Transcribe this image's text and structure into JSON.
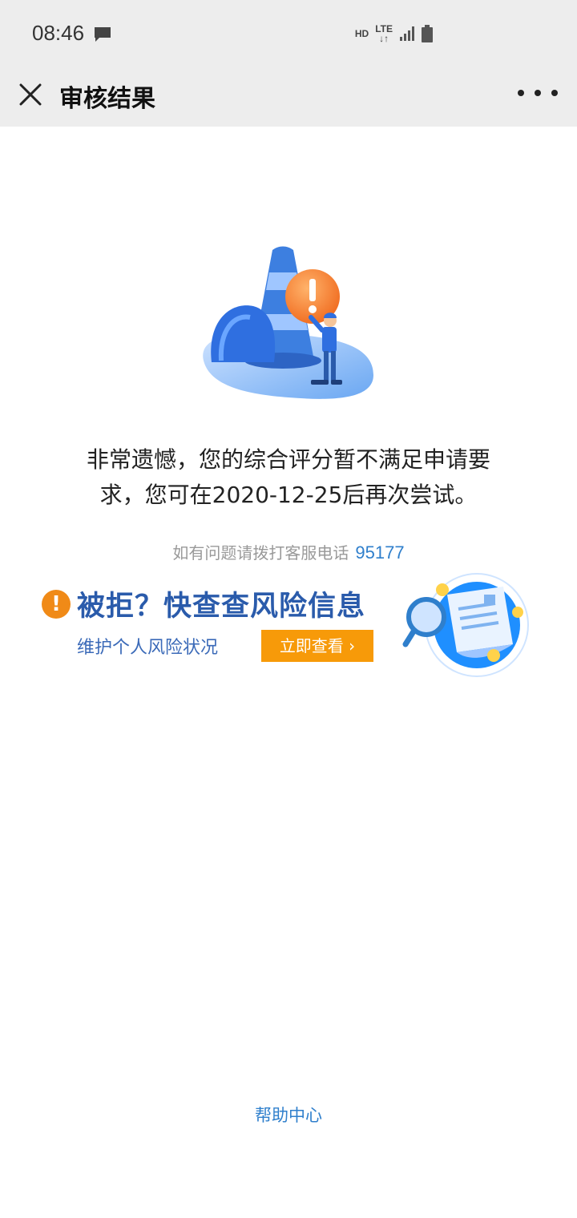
{
  "status_bar": {
    "time": "08:46",
    "hd": "HD",
    "lte": "LTE",
    "icons": [
      "message-icon",
      "signal-icon",
      "battery-icon"
    ]
  },
  "nav": {
    "title": "审核结果",
    "close_icon": "close-icon",
    "more_icon": "more-icon"
  },
  "result": {
    "message": "非常遗憾，您的综合评分暂不满足申请要求，您可在2020-12-25后再次尝试。",
    "help_text": "如有问题请拨打客服电话",
    "help_phone": "95177"
  },
  "banner": {
    "title": "被拒？快查查风险信息",
    "subtitle": "维护个人风险状况",
    "cta": "立即查看 ›"
  },
  "footer": {
    "help_center": "帮助中心"
  },
  "colors": {
    "accent_blue": "#2f7fcc",
    "banner_blue": "#2a5bab",
    "cta_orange": "#f79a09",
    "warning_orange": "#f08a17",
    "bar_bg": "#ededed"
  }
}
